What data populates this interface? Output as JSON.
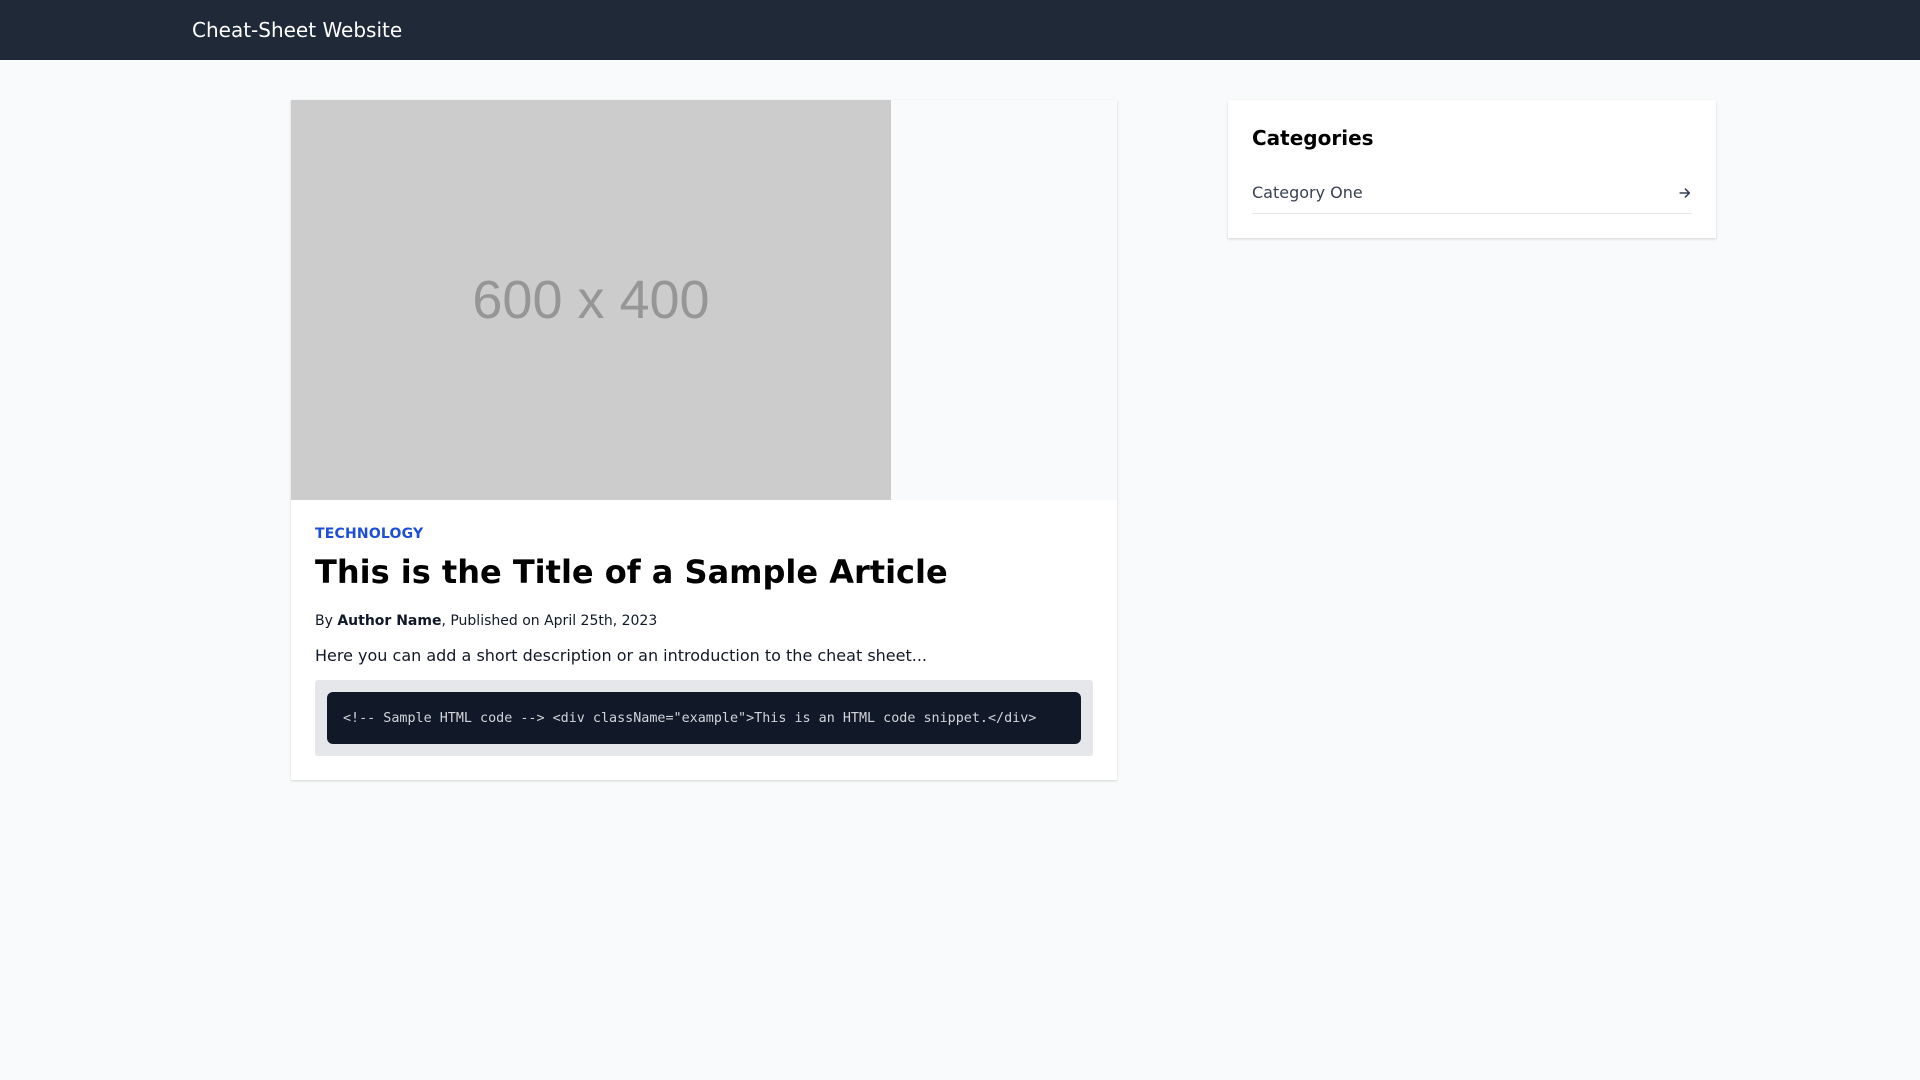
{
  "header": {
    "brand": "Cheat-Sheet Website",
    "background": "#1f2937"
  },
  "article": {
    "image_placeholder": "600 x 400",
    "category": "TECHNOLOGY",
    "title": "This is the Title of a Sample Article",
    "byline": {
      "prefix": "By ",
      "author": "Author Name",
      "published": ", Published on April 25th, 2023"
    },
    "description": "Here you can add a short description or an introduction to the cheat sheet...",
    "code_snippet": "<!-- Sample HTML code --> <div className=\"example\">This is an HTML code snippet.</div>",
    "accent_color": "#1d4ed8"
  },
  "sidebar": {
    "title": "Categories",
    "items": [
      {
        "label": "Category One",
        "icon": "arrow-right-icon"
      }
    ]
  }
}
